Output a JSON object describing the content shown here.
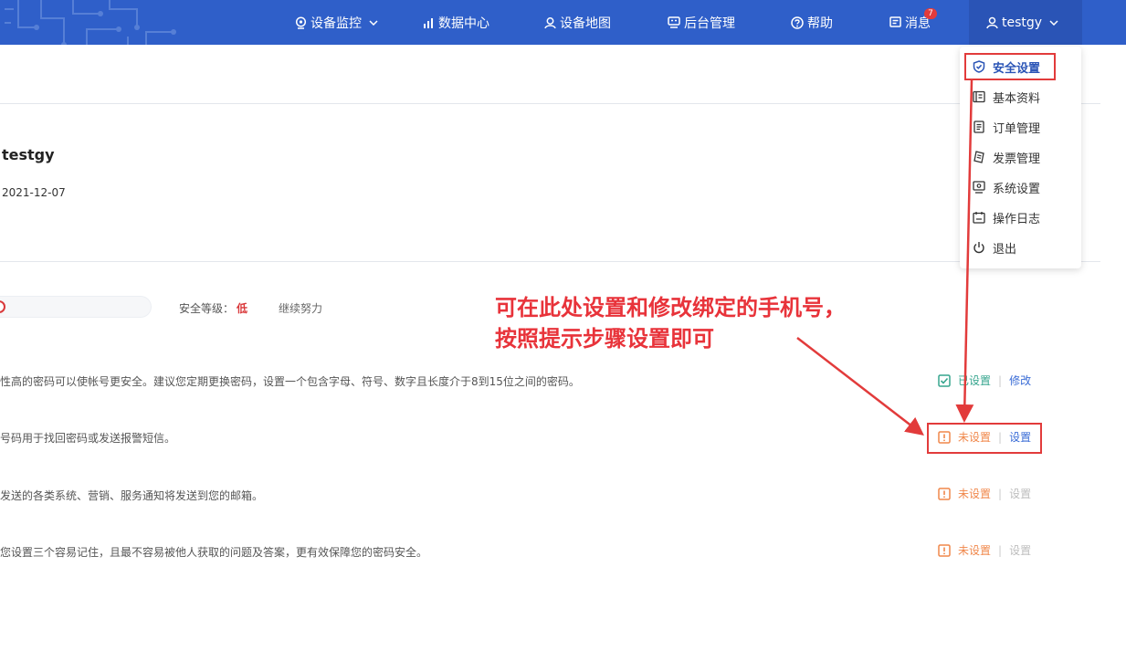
{
  "nav": {
    "items": [
      {
        "key": "monitor",
        "label": "设备监控",
        "icon": "webcam-icon",
        "has_dropdown": true
      },
      {
        "key": "data",
        "label": "数据中心",
        "icon": "chart-icon"
      },
      {
        "key": "map",
        "label": "设备地图",
        "icon": "map-pin-icon"
      },
      {
        "key": "admin",
        "label": "后台管理",
        "icon": "monitor-icon"
      },
      {
        "key": "help",
        "label": "帮助",
        "icon": "question-icon"
      },
      {
        "key": "msg",
        "label": "消息",
        "icon": "message-icon",
        "badge": "7"
      }
    ],
    "user": {
      "name": "testgy",
      "icon": "user-icon"
    },
    "colors": {
      "bar": "#2f5fc9",
      "user_box": "#2a54b6"
    }
  },
  "profile": {
    "username": "testgy",
    "date": "2021-12-07"
  },
  "security": {
    "level_label": "安全等级：",
    "level_value": "低",
    "hint": "继续努力",
    "rows": [
      {
        "desc": "性高的密码可以使帐号更安全。建议您定期更换密码，设置一个包含字母、符号、数字且长度介于8到15位之间的密码。",
        "status": "已设置",
        "action": "修改",
        "state": "ok"
      },
      {
        "desc": "号码用于找回密码或发送报警短信。",
        "status": "未设置",
        "action": "设置",
        "state": "warn"
      },
      {
        "desc": "发送的各类系统、营销、服务通知将发送到您的邮箱。",
        "status": "未设置",
        "action": "设置",
        "state": "warn-disabled"
      },
      {
        "desc": "您设置三个容易记住，且最不容易被他人获取的问题及答案，更有效保障您的密码安全。",
        "status": "未设置",
        "action": "设置",
        "state": "warn-disabled"
      }
    ],
    "colors": {
      "ok": "#36a58e",
      "warn": "#f0874a",
      "link": "#3a6cd6",
      "danger": "#d9383a"
    }
  },
  "menu": {
    "items": [
      {
        "label": "安全设置",
        "icon": "shield-icon",
        "active": true
      },
      {
        "label": "基本资料",
        "icon": "id-card-icon"
      },
      {
        "label": "订单管理",
        "icon": "document-icon"
      },
      {
        "label": "发票管理",
        "icon": "invoice-icon"
      },
      {
        "label": "系统设置",
        "icon": "monitor-settings-icon"
      },
      {
        "label": "操作日志",
        "icon": "calendar-icon"
      },
      {
        "label": "退出",
        "icon": "power-icon"
      }
    ]
  },
  "annotation": {
    "text": "可在此处设置和修改绑定的手机号，按照提示步骤设置即可",
    "color": "#e8333a"
  }
}
